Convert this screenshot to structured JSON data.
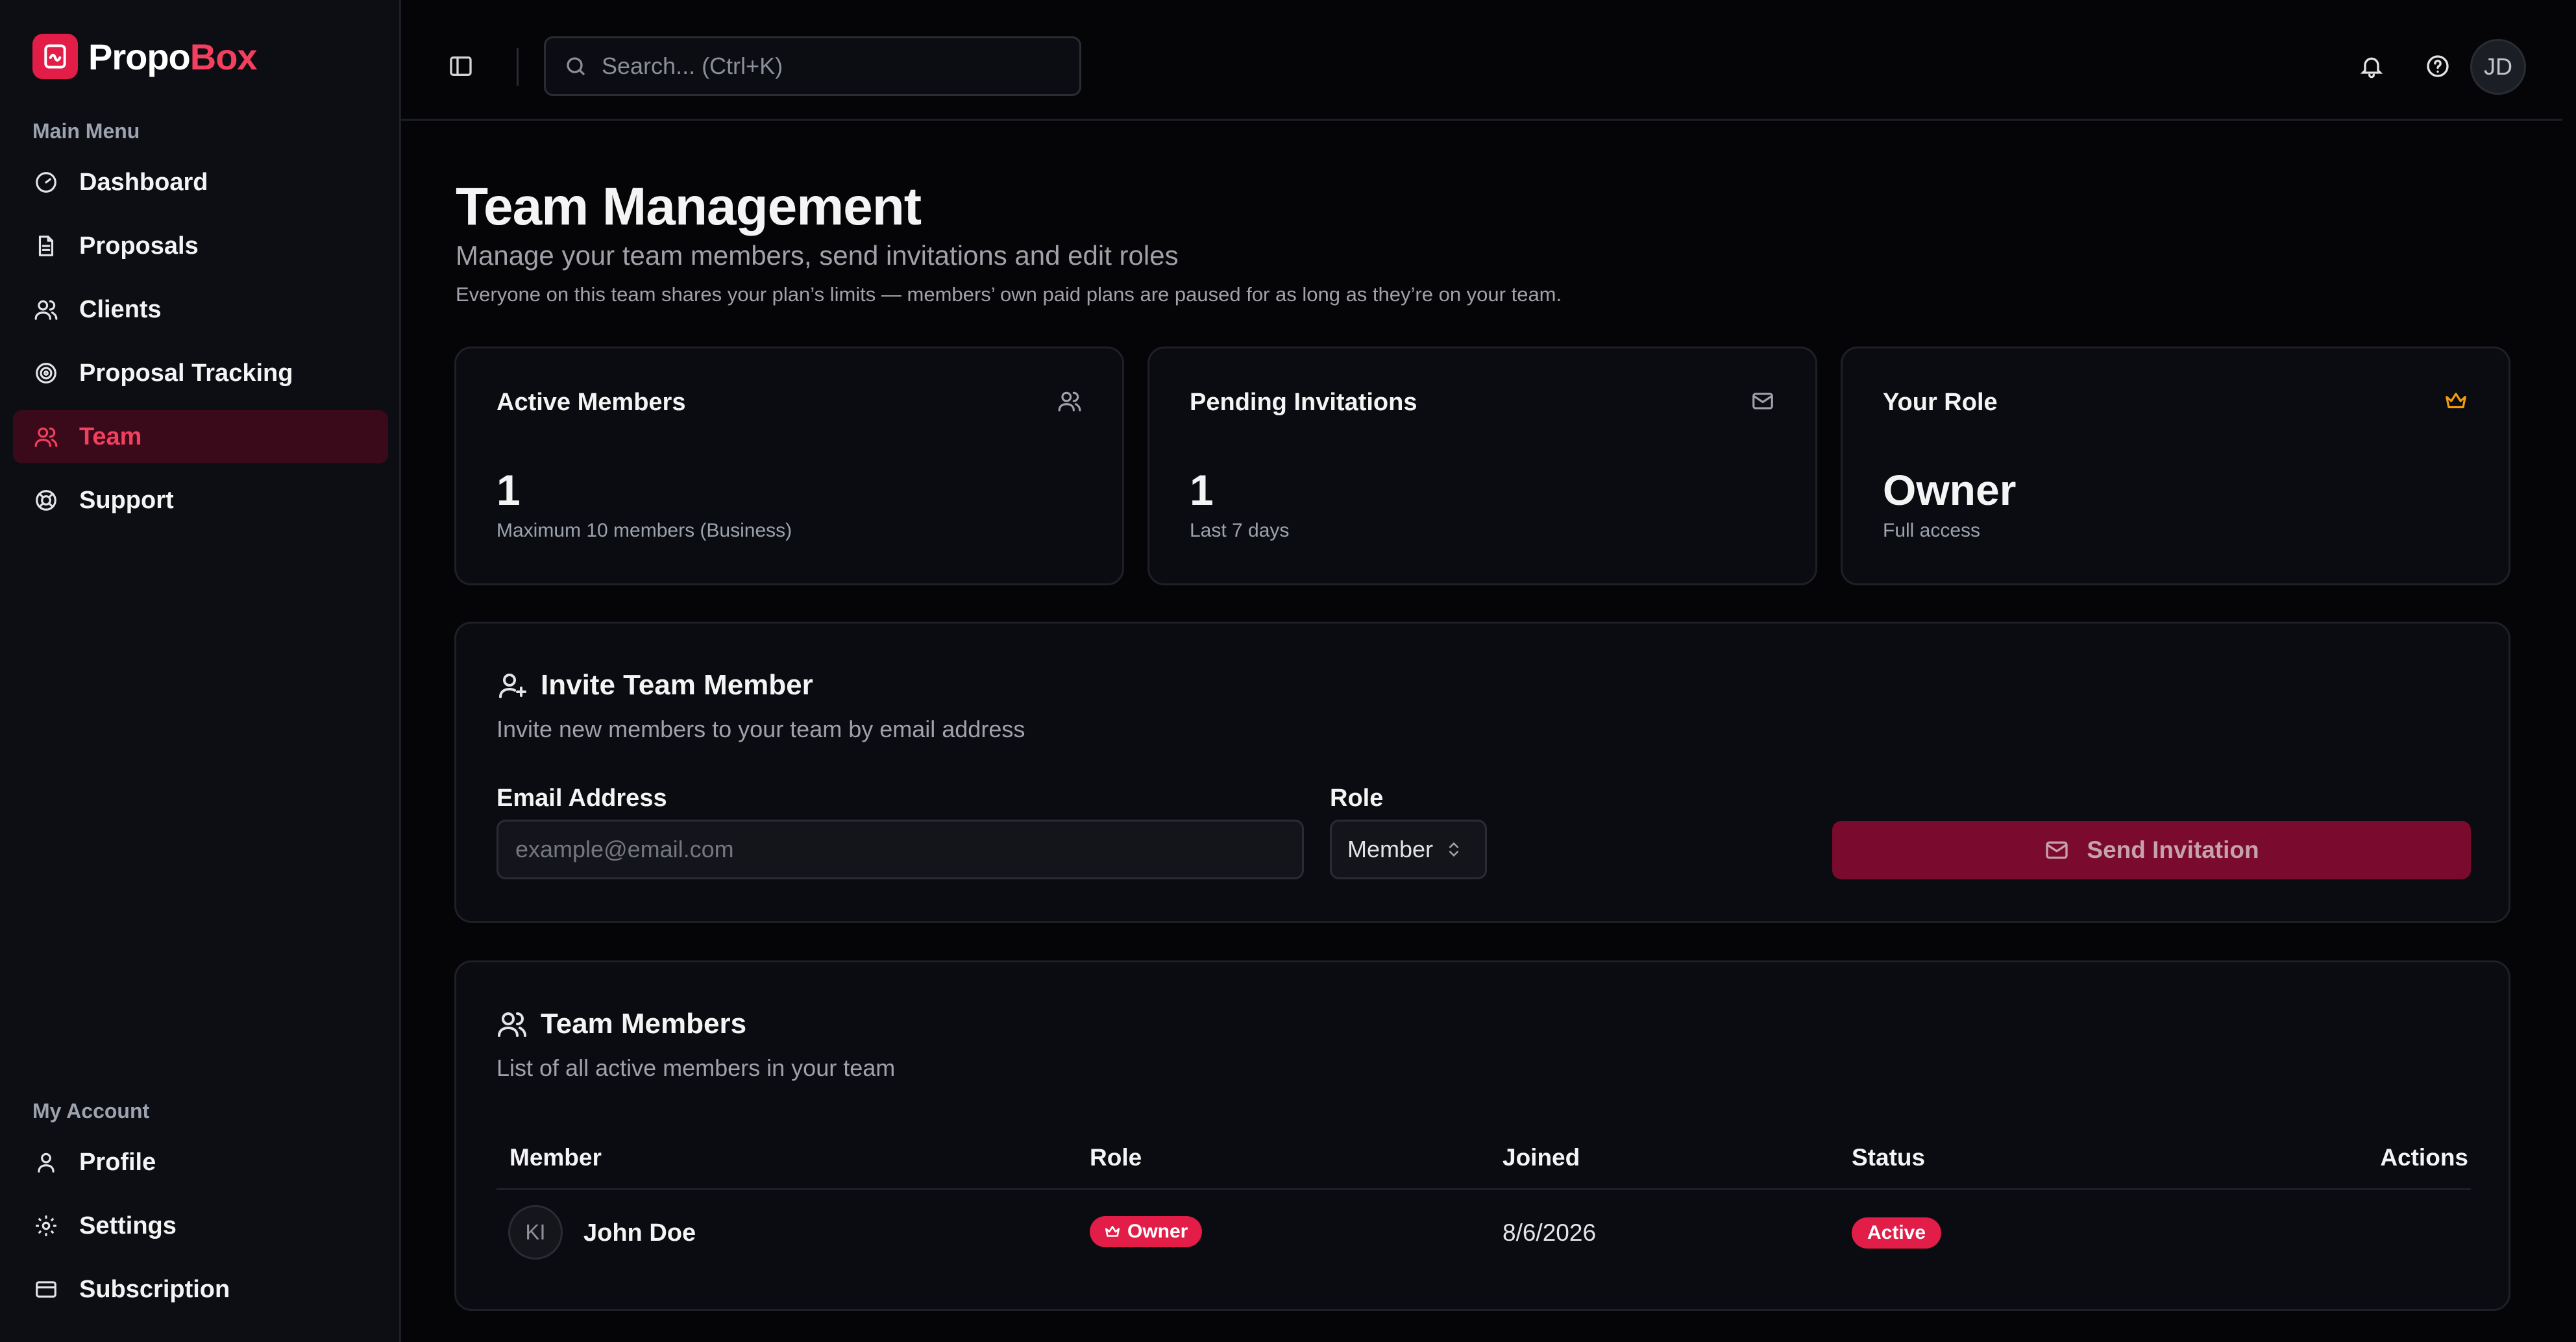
{
  "app": {
    "name_part1": "Propo",
    "name_part2": "Box",
    "brand_color": "#e11d48"
  },
  "sidebar": {
    "main_menu_label": "Main Menu",
    "main_items": [
      {
        "label": "Dashboard",
        "icon": "gauge-icon"
      },
      {
        "label": "Proposals",
        "icon": "document-icon"
      },
      {
        "label": "Clients",
        "icon": "users-icon"
      },
      {
        "label": "Proposal Tracking",
        "icon": "target-icon"
      },
      {
        "label": "Team",
        "icon": "team-icon",
        "active": true
      },
      {
        "label": "Support",
        "icon": "lifebuoy-icon"
      }
    ],
    "account_label": "My Account",
    "account_items": [
      {
        "label": "Profile",
        "icon": "user-icon"
      },
      {
        "label": "Settings",
        "icon": "gear-icon"
      },
      {
        "label": "Subscription",
        "icon": "credit-card-icon"
      }
    ]
  },
  "topbar": {
    "search_placeholder": "Search... (Ctrl+K)",
    "avatar_initials": "JD"
  },
  "page": {
    "title": "Team Management",
    "subtitle": "Manage your team members, send invitations and edit roles",
    "note": "Everyone on this team shares your plan’s limits — members’ own paid plans are paused for as long as they’re on your team."
  },
  "stats": [
    {
      "title": "Active Members",
      "value": "1",
      "caption": "Maximum 10 members (Business)",
      "icon": "users-icon"
    },
    {
      "title": "Pending Invitations",
      "value": "1",
      "caption": "Last 7 days",
      "icon": "mail-icon"
    },
    {
      "title": "Your Role",
      "value": "Owner",
      "caption": "Full access",
      "icon": "crown-icon",
      "icon_color": "#f59e0b"
    }
  ],
  "invite": {
    "title": "Invite Team Member",
    "description": "Invite new members to your team by email address",
    "email_label": "Email Address",
    "email_placeholder": "example@email.com",
    "email_value": "",
    "role_label": "Role",
    "role_value": "Member",
    "send_label": "Send Invitation"
  },
  "members": {
    "title": "Team Members",
    "description": "List of all active members in your team",
    "columns": [
      "Member",
      "Role",
      "Joined",
      "Status",
      "Actions"
    ],
    "rows": [
      {
        "initials": "KI",
        "name": "John Doe",
        "role": "Owner",
        "joined": "8/6/2026",
        "status": "Active"
      }
    ]
  }
}
